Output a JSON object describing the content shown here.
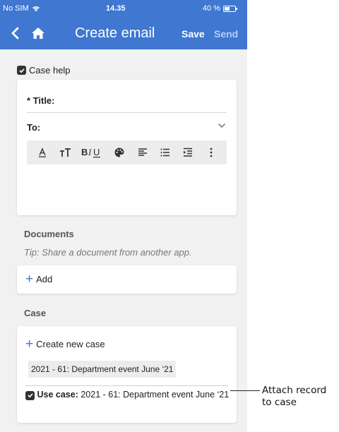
{
  "status_bar": {
    "carrier": "No SIM",
    "time": "14.35",
    "battery": "40 %"
  },
  "header": {
    "title": "Create email",
    "save_label": "Save",
    "send_label": "Send"
  },
  "case_help": {
    "label": "Case help",
    "checked": true
  },
  "email": {
    "title_label": "* Title:",
    "to_label": "To:",
    "toolbar": [
      "underline-a-icon",
      "text-size-icon",
      "bold-italic-underline-icon",
      "palette-icon",
      "align-left-icon",
      "bullet-list-icon",
      "indent-icon",
      "more-vertical-icon"
    ]
  },
  "documents": {
    "heading": "Documents",
    "tip": "Tip: Share a document from another app.",
    "add_label": "Add"
  },
  "case": {
    "heading": "Case",
    "create_label": "Create new case",
    "chip": "2021 - 61: Department event June ‘21",
    "use_label": "Use case:",
    "use_value": " 2021 - 61: Department event June ‘21",
    "use_checked": true
  },
  "annotation": {
    "line1": "Attach record",
    "line2": "to case"
  },
  "colors": {
    "header": "#3f77d1",
    "accent": "#3f77d1",
    "background": "#f1f1f1"
  }
}
